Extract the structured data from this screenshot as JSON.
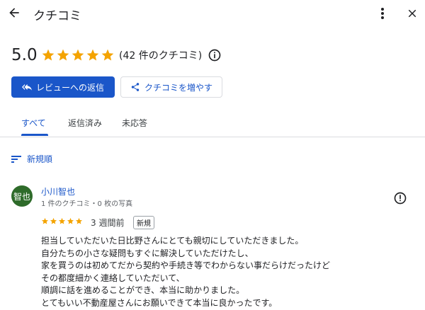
{
  "header": {
    "title": "クチコミ"
  },
  "summary": {
    "rating": "5.0",
    "stars": 5,
    "count_text": "(42 件のクチコミ)",
    "star_color": "#f4a300"
  },
  "actions": {
    "reply_label": "レビューへの返信",
    "increase_label": "クチコミを増やす",
    "accent": "#1a56c9"
  },
  "tabs": [
    {
      "label": "すべて",
      "active": true
    },
    {
      "label": "返信済み",
      "active": false
    },
    {
      "label": "未応答",
      "active": false
    }
  ],
  "sort": {
    "label": "新規順"
  },
  "review": {
    "avatar_text": "智也",
    "reviewer_name": "小川智也",
    "reviewer_meta": "1 件のクチコミ・0 枚の写真",
    "stars": 5,
    "time": "3 週間前",
    "badge": "新規",
    "lines": [
      "担当していただいた日比野さんにとても親切にしていただきました。",
      "自分たちの小さな疑問もすぐに解決していただけたし、",
      "家を買うのは初めてだから契約や手続き等でわからない事だらけだったけど",
      "その都度細かく連絡していただいて、",
      "順調に話を進めることができ、本当に助かりました。",
      "とてもいい不動産屋さんにお願いできて本当に良かったです。"
    ]
  }
}
